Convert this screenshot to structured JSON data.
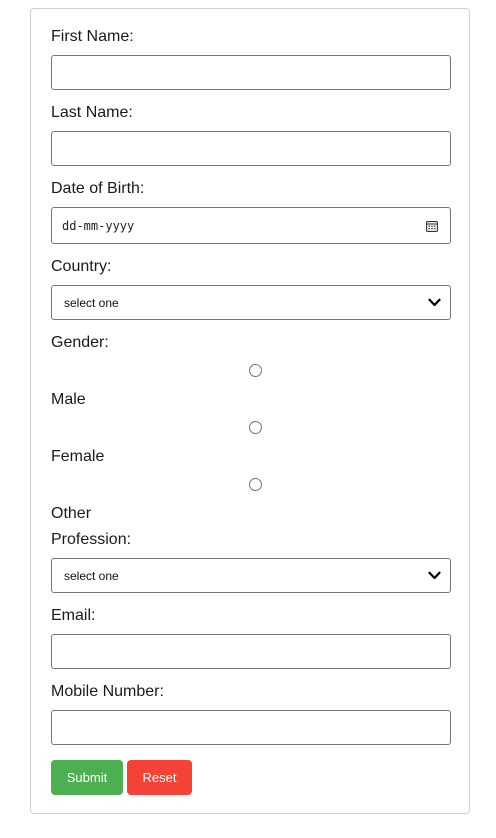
{
  "form": {
    "first_name": {
      "label": "First Name:",
      "value": ""
    },
    "last_name": {
      "label": "Last Name:",
      "value": ""
    },
    "dob": {
      "label": "Date of Birth:",
      "placeholder": "dd-mm-yyyy",
      "icon": "calendar-icon"
    },
    "country": {
      "label": "Country:",
      "selected": "select one",
      "icon": "chevron-down-icon"
    },
    "gender": {
      "label": "Gender:",
      "options": [
        {
          "label": "Male",
          "checked": false
        },
        {
          "label": "Female",
          "checked": false
        },
        {
          "label": "Other",
          "checked": false
        }
      ]
    },
    "profession": {
      "label": "Profession:",
      "selected": "select one",
      "icon": "chevron-down-icon"
    },
    "email": {
      "label": "Email:",
      "value": ""
    },
    "mobile": {
      "label": "Mobile Number:",
      "value": ""
    },
    "buttons": {
      "submit": "Submit",
      "reset": "Reset"
    }
  },
  "colors": {
    "submit_bg": "#4caf50",
    "reset_bg": "#f44336",
    "border": "#767676",
    "card_border": "#cfcfcf"
  }
}
